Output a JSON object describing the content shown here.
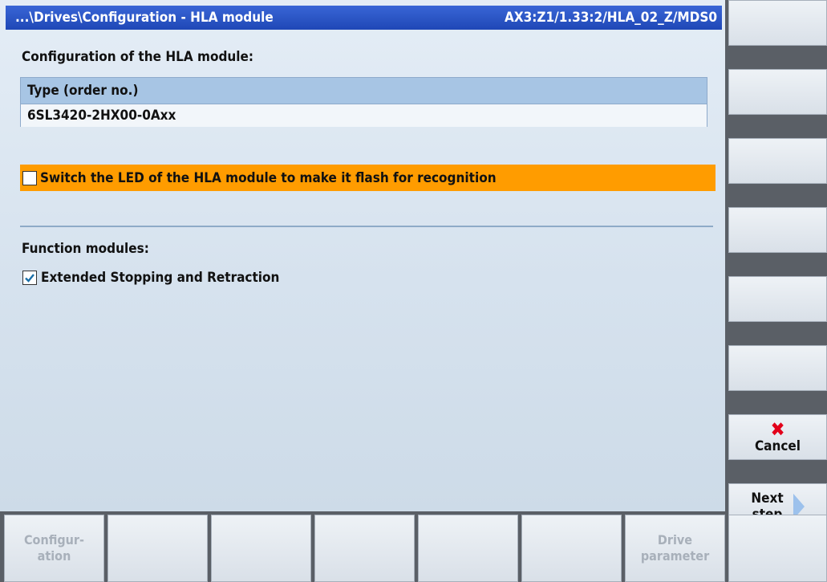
{
  "header": {
    "path": "...\\Drives\\Configuration - HLA module",
    "axis": "AX3:Z1/1.33:2/HLA_02_Z/MDS0"
  },
  "config_heading": "Configuration of the HLA module:",
  "type_table": {
    "column_header": "Type (order no.)",
    "value": "6SL3420-2HX00-0Axx"
  },
  "led_option": {
    "label": "Switch the LED of the HLA module to make it flash for recognition",
    "checked": false
  },
  "function_modules": {
    "heading": "Function modules:",
    "items": [
      {
        "label": "Extended Stopping and Retraction",
        "checked": true
      }
    ]
  },
  "vertical_softkeys": {
    "cancel": {
      "label": "Cancel",
      "icon": "red-x-icon"
    },
    "next": {
      "line1": "Next",
      "line2": "step",
      "icon": "right-arrow-icon"
    }
  },
  "horizontal_softkeys": {
    "key1": {
      "line1": "Configur-",
      "line2": "ation"
    },
    "key7": {
      "line1": "Drive",
      "line2": "parameter"
    }
  },
  "colors": {
    "title_bar": "#2a55c8",
    "highlight_row": "#ff9c00",
    "check_mark": "#1a6fa8",
    "cancel_x": "#e2001a",
    "next_arrow": "#9cc1ec",
    "disabled_text": "#a8b0ba"
  }
}
